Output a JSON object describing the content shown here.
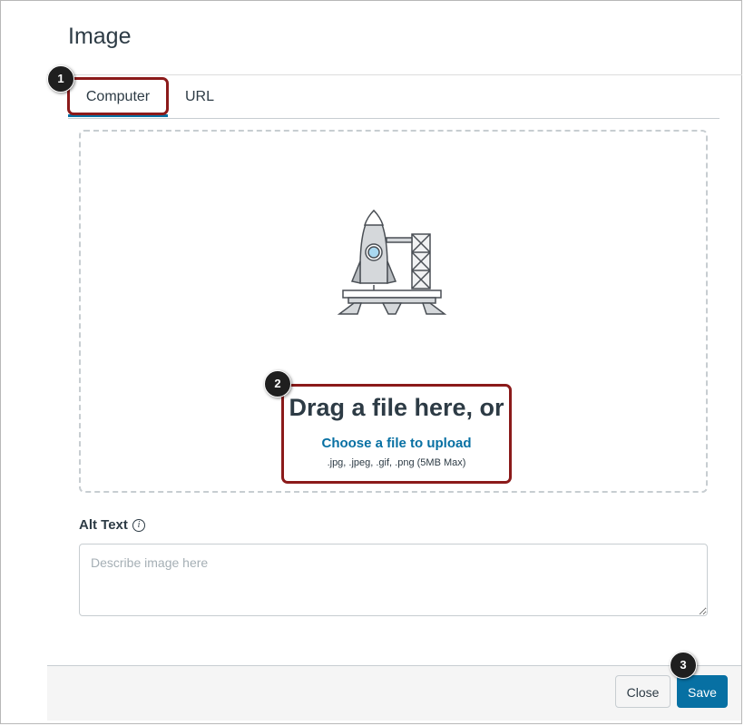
{
  "dialog": {
    "title": "Image"
  },
  "tabs": [
    {
      "label": "Computer",
      "selected": true
    },
    {
      "label": "URL",
      "selected": false
    }
  ],
  "dropzone": {
    "title": "Drag a file here, or",
    "link": "Choose a file to upload",
    "hint": ".jpg, .jpeg, .gif, .png (5MB Max)",
    "illustration": "rocket-launch-icon"
  },
  "alt_text": {
    "label": "Alt Text",
    "info_icon": "info-icon",
    "info_glyph": "i",
    "placeholder": "Describe image here",
    "value": ""
  },
  "footer": {
    "close_label": "Close",
    "save_label": "Save"
  },
  "callouts": [
    "1",
    "2",
    "3"
  ],
  "colors": {
    "accent": "#0770a3",
    "highlight": "#8b1a1a",
    "text": "#2d3b45"
  }
}
